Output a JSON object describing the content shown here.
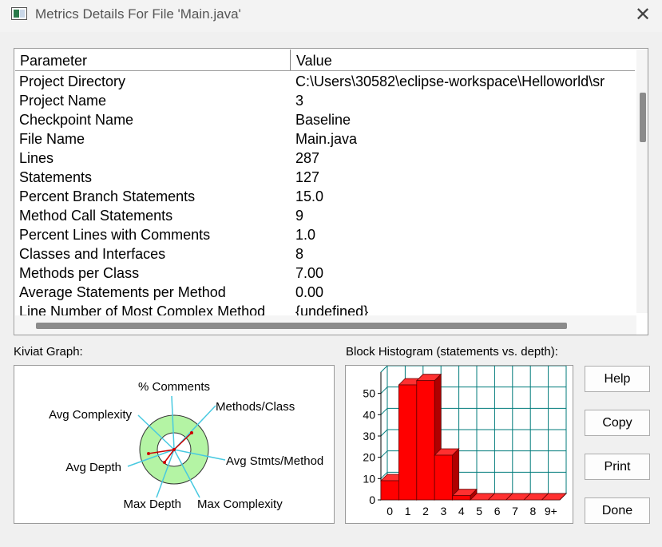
{
  "window": {
    "title": "Metrics Details For File 'Main.java'",
    "close_glyph": "✕"
  },
  "table": {
    "headers": {
      "parameter": "Parameter",
      "value": "Value"
    },
    "rows": [
      {
        "parameter": "Project Directory",
        "value": "C:\\Users\\30582\\eclipse-workspace\\Helloworld\\sr"
      },
      {
        "parameter": "Project Name",
        "value": "3"
      },
      {
        "parameter": "Checkpoint Name",
        "value": "Baseline"
      },
      {
        "parameter": "File Name",
        "value": "Main.java"
      },
      {
        "parameter": "Lines",
        "value": "287"
      },
      {
        "parameter": "Statements",
        "value": "127"
      },
      {
        "parameter": "Percent Branch Statements",
        "value": "15.0"
      },
      {
        "parameter": "Method Call Statements",
        "value": "9"
      },
      {
        "parameter": "Percent Lines with Comments",
        "value": "1.0"
      },
      {
        "parameter": "Classes and Interfaces",
        "value": "8"
      },
      {
        "parameter": "Methods per Class",
        "value": "7.00"
      },
      {
        "parameter": "Average Statements per Method",
        "value": "0.00"
      },
      {
        "parameter": "Line Number of Most Complex Method",
        "value": "{undefined}"
      }
    ]
  },
  "kiviat": {
    "label": "Kiviat Graph:",
    "axes": {
      "comments": "% Comments",
      "methods_class": "Methods/Class",
      "avg_stmts": "Avg Stmts/Method",
      "max_complexity": "Max Complexity",
      "max_depth": "Max Depth",
      "avg_depth": "Avg Depth",
      "avg_complexity": "Avg Complexity"
    },
    "colors": {
      "ring": "#b4f4a4",
      "axis": "#48c9e0",
      "profile": "#cc0000"
    }
  },
  "histogram": {
    "label": "Block Histogram (statements vs. depth):",
    "chart_data": {
      "type": "bar",
      "categories": [
        "0",
        "1",
        "2",
        "3",
        "4",
        "5",
        "6",
        "7",
        "8",
        "9+"
      ],
      "values": [
        9,
        54,
        56,
        21,
        2,
        0,
        0,
        0,
        0,
        0
      ],
      "ylim": [
        0,
        60
      ],
      "yticks": [
        "0",
        "10",
        "20",
        "30",
        "40",
        "50"
      ],
      "bar_color": "#ff0000",
      "grid_color": "#007b7b"
    }
  },
  "buttons": {
    "help": "Help",
    "copy": "Copy",
    "print": "Print",
    "done": "Done"
  }
}
